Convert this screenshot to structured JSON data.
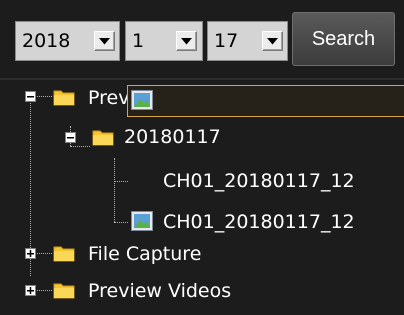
{
  "date_selectors": {
    "year": "2018",
    "month": "1",
    "day": "17"
  },
  "search_label": "Search",
  "tree": {
    "preview_capture": {
      "label": "Preview Capture",
      "expanded": true,
      "date_folder": {
        "label": "20180117",
        "expanded": true,
        "files": [
          {
            "label": "CH01_20180117_12",
            "selected": true
          },
          {
            "label": "CH01_20180117_12",
            "selected": false
          }
        ]
      }
    },
    "file_capture": {
      "label": "File Capture",
      "expanded": false
    },
    "preview_videos": {
      "label": "Preview Videos",
      "expanded": false
    }
  },
  "colors": {
    "background": "#1c1c1c",
    "folder": "#f5c431",
    "selection_border": "#d9a441"
  }
}
